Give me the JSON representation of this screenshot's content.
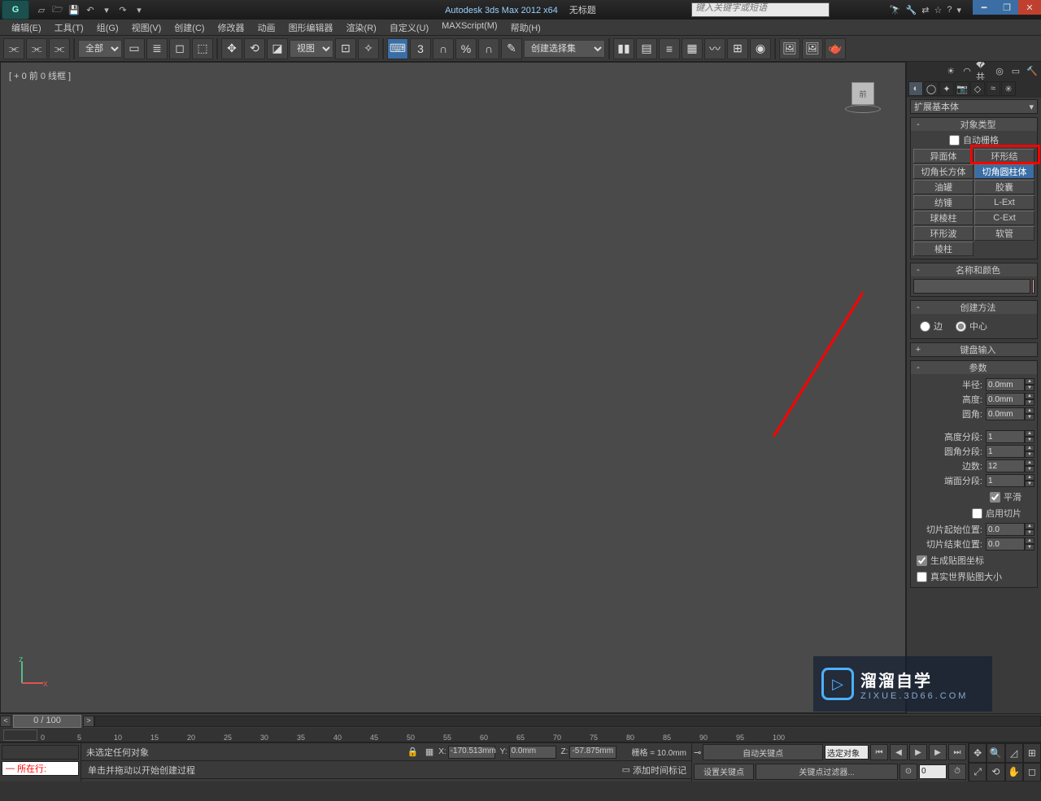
{
  "title": {
    "app": "Autodesk 3ds Max 2012 x64",
    "doc": "无标题"
  },
  "search_placeholder": "键入关键字或短语",
  "menus": [
    "编辑(E)",
    "工具(T)",
    "组(G)",
    "视图(V)",
    "创建(C)",
    "修改器",
    "动画",
    "图形编辑器",
    "渲染(R)",
    "自定义(U)",
    "MAXScript(M)",
    "帮助(H)"
  ],
  "toolbar": {
    "filter_all": "全部",
    "ref_dropdown": "视图",
    "named_sel": "创建选择集"
  },
  "viewport": {
    "label": "[ + 0 前 0 线框 ]"
  },
  "cmd_panel": {
    "dropdown": "扩展基本体",
    "object_type": {
      "title": "对象类型",
      "autogrid": "自动栅格",
      "buttons": [
        [
          "异面体",
          "环形结"
        ],
        [
          "切角长方体",
          "切角圆柱体"
        ],
        [
          "油罐",
          "胶囊"
        ],
        [
          "纺锤",
          "L-Ext"
        ],
        [
          "球棱柱",
          "C-Ext"
        ],
        [
          "环形波",
          "软管"
        ],
        [
          "棱柱",
          ""
        ]
      ],
      "selected": "切角圆柱体"
    },
    "name_color": {
      "title": "名称和颜色"
    },
    "creation_method": {
      "title": "创建方法",
      "edge": "边",
      "center": "中心"
    },
    "keyboard_entry": {
      "title": "键盘输入"
    },
    "parameters": {
      "title": "参数",
      "radius": {
        "lbl": "半径:",
        "val": "0.0mm"
      },
      "height": {
        "lbl": "高度:",
        "val": "0.0mm"
      },
      "fillet": {
        "lbl": "圆角:",
        "val": "0.0mm"
      },
      "height_segs": {
        "lbl": "高度分段:",
        "val": "1"
      },
      "fillet_segs": {
        "lbl": "圆角分段:",
        "val": "1"
      },
      "sides": {
        "lbl": "边数:",
        "val": "12"
      },
      "cap_segs": {
        "lbl": "端面分段:",
        "val": "1"
      },
      "smooth": "平滑",
      "slice_on": "启用切片",
      "slice_from": {
        "lbl": "切片起始位置:",
        "val": "0.0"
      },
      "slice_to": {
        "lbl": "切片结束位置:",
        "val": "0.0"
      },
      "gen_map": "生成贴图坐标",
      "real_world": "真实世界贴图大小"
    }
  },
  "timeline": {
    "pos": "0 / 100",
    "ticks": [
      "0",
      "5",
      "10",
      "15",
      "20",
      "25",
      "30",
      "35",
      "40",
      "45",
      "50",
      "55",
      "60",
      "65",
      "70",
      "75",
      "80",
      "85",
      "90",
      "95",
      "100"
    ]
  },
  "status": {
    "running": "所在行:",
    "sel": "未选定任何对象",
    "x": "-170.513mm",
    "y": "0.0mm",
    "z": "-57.875mm",
    "grid": "栅格 = 10.0mm",
    "hint": "单击并拖动以开始创建过程",
    "add_tag": "添加时间标记",
    "auto_key": "自动关键点",
    "set_key": "设置关键点",
    "sel_filter": "选定对象",
    "key_filter": "关键点过滤器..."
  },
  "watermark": {
    "big": "溜溜自学",
    "small": "ZIXUE.3D66.COM"
  }
}
